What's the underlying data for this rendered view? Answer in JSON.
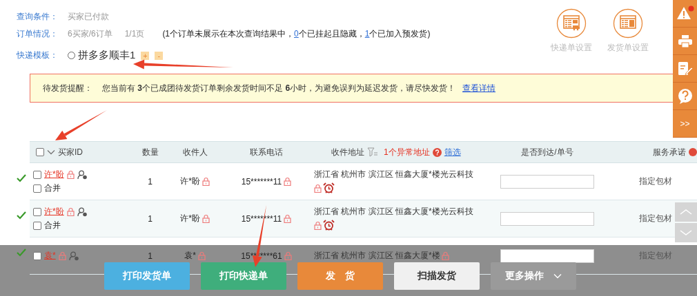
{
  "query": {
    "label": "查询条件：",
    "value": "买家已付款"
  },
  "orders": {
    "label": "订单情况：",
    "counts": "6买家/6订单",
    "pages": "1/1页",
    "note": [
      {
        "kind": "text",
        "text": "(1个订单未展示在本次查询结果中，"
      },
      {
        "kind": "link",
        "text": "0"
      },
      {
        "kind": "text",
        "text": "个已挂起且隐藏，"
      },
      {
        "kind": "link",
        "text": "1"
      },
      {
        "kind": "text",
        "text": "个已加入预发货)"
      }
    ]
  },
  "template": {
    "label": "快递模板：",
    "options": [
      {
        "label": "拼多多顺丰1",
        "selected": false
      }
    ],
    "add": "+",
    "remove": "-"
  },
  "settings": [
    {
      "kind": "express",
      "label": "快递单设置"
    },
    {
      "kind": "invoice",
      "label": "发货单设置"
    }
  ],
  "alert": {
    "label": "待发货提醒：",
    "message": "您当前有 **3**个已成团待发货订单剩余发货时间不足 **6**小时，为避免误判为延迟发货，请尽快发货！",
    "link": "查看详情"
  },
  "sidebar": [
    {
      "kind": "warning",
      "notification": true
    },
    {
      "kind": "print"
    },
    {
      "kind": "edit"
    },
    {
      "kind": "help"
    },
    {
      "kind": "expand",
      "text": ">>"
    }
  ],
  "table": {
    "select_all": false,
    "columns": [
      {
        "kind": "buyer",
        "label": "买家ID"
      },
      {
        "kind": "plain",
        "label": "数量"
      },
      {
        "kind": "plain",
        "label": "收件人"
      },
      {
        "kind": "plain",
        "label": "联系电话"
      },
      {
        "kind": "address",
        "label": "收件地址",
        "abnormal": "1个异常地址",
        "filter": "筛选"
      },
      {
        "kind": "plain",
        "label": "是否到达/单号"
      },
      {
        "kind": "service",
        "label": "服务承诺"
      }
    ],
    "rows": [
      {
        "verified": true,
        "checked": false,
        "buyer": "许*盼",
        "merge": {
          "label": "合并",
          "checked": false
        },
        "qty": "1",
        "receiver": "许*盼",
        "phone": "15*******11",
        "address": "浙江省 杭州市 滨江区 恒鑫大厦*楼光云科技",
        "alarm": true,
        "service": "指定包材"
      },
      {
        "verified": true,
        "checked": false,
        "buyer": "许*盼",
        "merge": {
          "label": "合并",
          "checked": false
        },
        "qty": "1",
        "receiver": "许*盼",
        "phone": "15*******11",
        "address": "浙江省 杭州市 滨江区 恒鑫大厦*楼光云科技",
        "alarm": true,
        "service": "指定包材"
      },
      {
        "verified": true,
        "checked": false,
        "buyer": "袁*",
        "qty": "1",
        "receiver": "袁*",
        "phone": "15*******61",
        "address": "浙江省 杭州市 滨江区 恒鑫大厦*楼",
        "alarm": false,
        "service": "指定包材"
      }
    ]
  },
  "actions": [
    {
      "kind": "blue",
      "label": "打印发货单"
    },
    {
      "kind": "green",
      "label": "打印快递单"
    },
    {
      "kind": "orange",
      "label": "发　货"
    },
    {
      "kind": "light",
      "label": "扫描发货"
    },
    {
      "kind": "grey",
      "label": "更多操作",
      "dropdown": true
    }
  ]
}
